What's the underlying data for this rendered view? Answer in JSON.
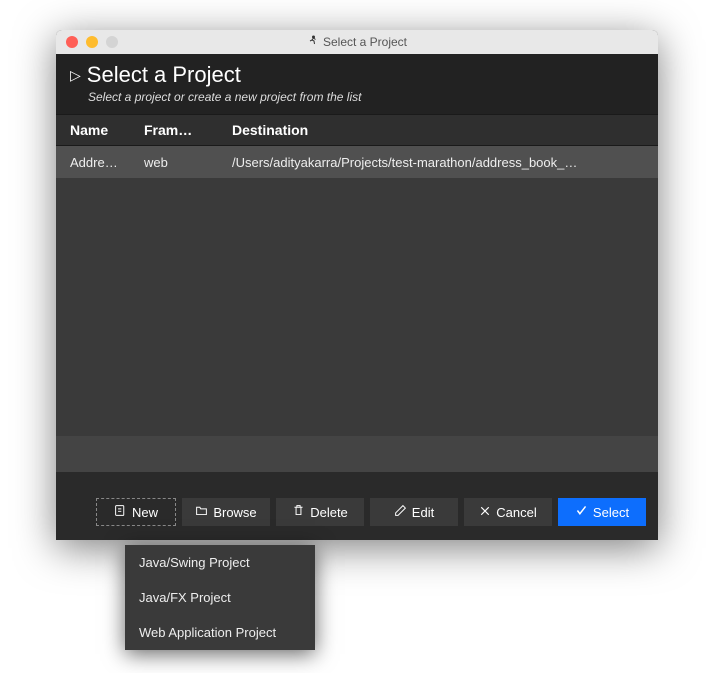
{
  "titlebar": {
    "title": "Select a Project"
  },
  "header": {
    "title": "Select a Project",
    "subtitle": "Select a project or create a new project from the list"
  },
  "table": {
    "columns": {
      "name": "Name",
      "framework": "Fram…",
      "destination": "Destination"
    },
    "rows": [
      {
        "name": "Addre…",
        "framework": "web",
        "destination": "/Users/adityakarra/Projects/test-marathon/address_book_…"
      }
    ]
  },
  "buttons": {
    "new": "New",
    "browse": "Browse",
    "delete": "Delete",
    "edit": "Edit",
    "cancel": "Cancel",
    "select": "Select"
  },
  "dropdown": {
    "items": [
      "Java/Swing Project",
      "Java/FX Project",
      "Web Application Project"
    ]
  }
}
